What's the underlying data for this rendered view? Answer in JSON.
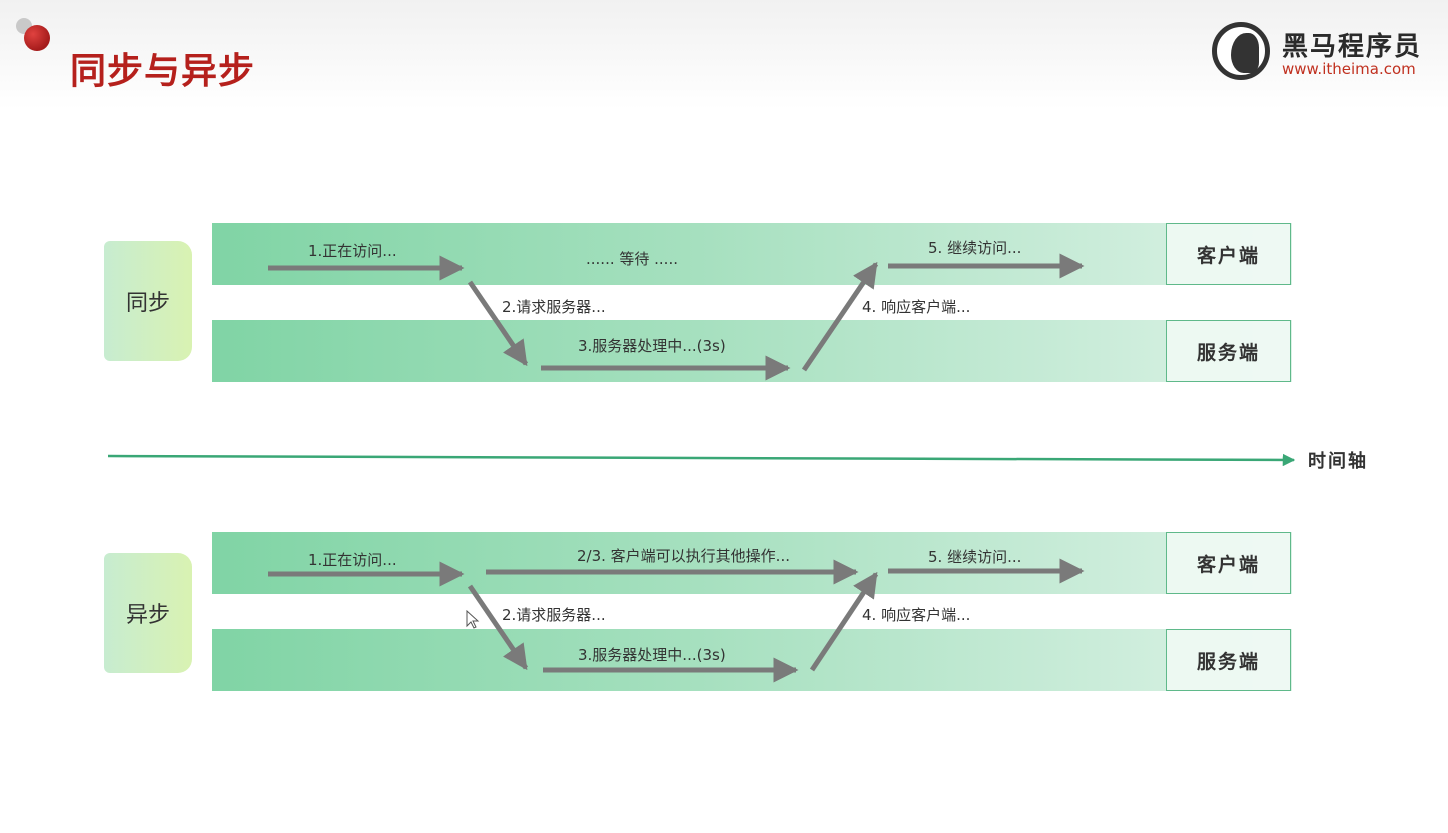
{
  "header": {
    "title": "同步与异步",
    "logo_name": "黑马程序员",
    "logo_url": "www.itheima.com"
  },
  "sync": {
    "label": "同步",
    "client_label": "客户端",
    "server_label": "服务端",
    "step1": "1.正在访问...",
    "wait": "...... 等待 .....",
    "step2": "2.请求服务器...",
    "step3": "3.服务器处理中...(3s)",
    "step4": "4. 响应客户端...",
    "step5": "5. 继续访问..."
  },
  "timeline": {
    "label": "时间轴"
  },
  "async": {
    "label": "异步",
    "client_label": "客户端",
    "server_label": "服务端",
    "step1": "1.正在访问...",
    "step23": "2/3. 客户端可以执行其他操作...",
    "step2": "2.请求服务器...",
    "step3": "3.服务器处理中...(3s)",
    "step4": "4. 响应客户端...",
    "step5": "5. 继续访问..."
  },
  "colors": {
    "title_red": "#b5201c",
    "arrow_gray": "#7a7a7a",
    "timeline_green": "#3aa776",
    "band_green": "#80d4a5"
  },
  "icons": {
    "cursor": "mouse-pointer-icon",
    "logo": "horse-logo-icon"
  }
}
